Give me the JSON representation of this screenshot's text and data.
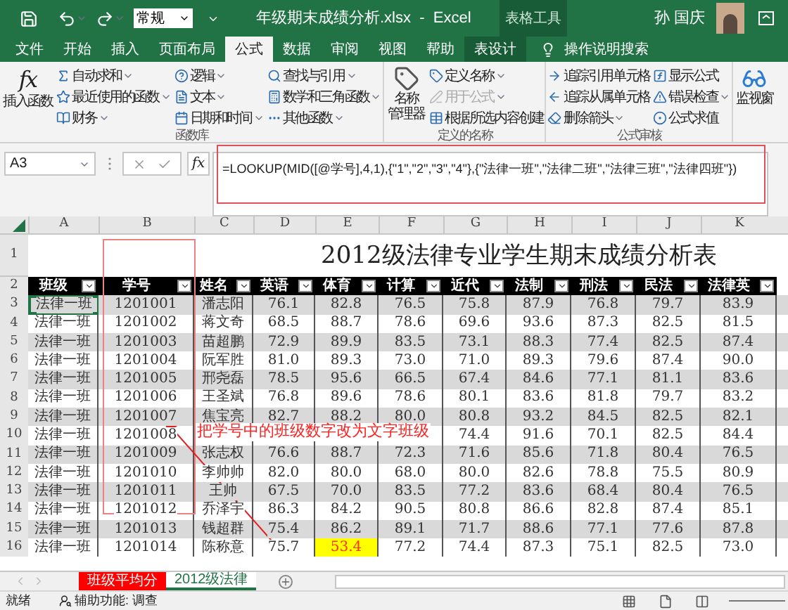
{
  "title_bar": {
    "number_format": "常规",
    "file_title": "年级期末成绩分析.xlsx  -  Excel",
    "context_tab": "表格工具",
    "user": "孙 国庆"
  },
  "tabs": [
    {
      "label": "文件",
      "selected": false,
      "kind": "normal"
    },
    {
      "label": "开始",
      "selected": false,
      "kind": "normal"
    },
    {
      "label": "插入",
      "selected": false,
      "kind": "normal"
    },
    {
      "label": "页面布局",
      "selected": false,
      "kind": "normal"
    },
    {
      "label": "公式",
      "selected": true,
      "kind": "normal"
    },
    {
      "label": "数据",
      "selected": false,
      "kind": "normal"
    },
    {
      "label": "审阅",
      "selected": false,
      "kind": "normal"
    },
    {
      "label": "视图",
      "selected": false,
      "kind": "normal"
    },
    {
      "label": "帮助",
      "selected": false,
      "kind": "normal"
    },
    {
      "label": "表设计",
      "selected": false,
      "kind": "contextual"
    }
  ],
  "search_hint": "操作说明搜索",
  "ribbon_groups": [
    {
      "label": "函数库",
      "large": [
        {
          "icon_text": "fx",
          "lines": [
            "插入函数"
          ]
        }
      ],
      "columns": [
        [
          {
            "label": "自动求和",
            "dropdown": true,
            "disabled": false
          },
          {
            "label": "最近使用的函数",
            "dropdown": true,
            "disabled": false
          },
          {
            "label": "财务",
            "dropdown": true,
            "disabled": false
          }
        ],
        [
          {
            "label": "逻辑",
            "dropdown": true,
            "disabled": false
          },
          {
            "label": "文本",
            "dropdown": true,
            "disabled": false
          },
          {
            "label": "日期和时间",
            "dropdown": true,
            "disabled": false
          }
        ],
        [
          {
            "label": "查找与引用",
            "dropdown": true,
            "disabled": false
          },
          {
            "label": "数学和三角函数",
            "dropdown": true,
            "disabled": false
          },
          {
            "label": "其他函数",
            "dropdown": true,
            "disabled": false
          }
        ]
      ]
    },
    {
      "label": "定义的名称",
      "large": [
        {
          "lines": [
            "名称",
            "管理器"
          ]
        }
      ],
      "columns": [
        [
          {
            "label": "定义名称",
            "dropdown": true,
            "disabled": false
          },
          {
            "label": "用于公式",
            "dropdown": true,
            "disabled": true
          },
          {
            "label": "根据所选内容创建",
            "dropdown": false,
            "disabled": false
          }
        ]
      ]
    },
    {
      "label": "公式审核",
      "columns": [
        [
          {
            "label": "追踪引用单元格",
            "dropdown": false,
            "disabled": false
          },
          {
            "label": "追踪从属单元格",
            "dropdown": false,
            "disabled": false
          },
          {
            "label": "删除箭头",
            "dropdown": true,
            "disabled": false
          }
        ],
        [
          {
            "label": "显示公式",
            "dropdown": false,
            "disabled": false
          },
          {
            "label": "错误检查",
            "dropdown": true,
            "disabled": false
          },
          {
            "label": "公式求值",
            "dropdown": false,
            "disabled": false
          }
        ]
      ]
    },
    {
      "large": [
        {
          "lines": [
            "监视窗"
          ]
        }
      ]
    }
  ],
  "formula_bar": {
    "name_box": "A3",
    "fx": "fx",
    "formula": "=LOOKUP(MID([@学号],4,1),{\"1\",\"2\",\"3\",\"4\"},{\"法律一班\",\"法律二班\",\"法律三班\",\"法律四班\"})"
  },
  "sheet": {
    "columns": [
      "A",
      "B",
      "C",
      "D",
      "E",
      "F",
      "G",
      "H",
      "I",
      "J",
      "K"
    ],
    "title_row": "1",
    "title": "2012级法律专业学生期末成绩分析表",
    "header_row": "2",
    "headers": [
      "班级",
      "学号",
      "姓名",
      "英语",
      "体育",
      "计算",
      "近代",
      "法制",
      "刑法",
      "民法",
      "法律英"
    ],
    "rows": [
      {
        "number": "3",
        "selected": {
          "A": true
        },
        "cells": {
          "A": "法律一班",
          "B": "1201001",
          "C": "潘志阳",
          "D": "76.1",
          "E": "82.8",
          "F": "76.5",
          "G": "75.8",
          "H": "87.9",
          "I": "76.8",
          "J": "79.7",
          "K": "83.9"
        }
      },
      {
        "number": "4",
        "cells": {
          "A": "法律一班",
          "B": "1201002",
          "C": "蒋文奇",
          "D": "68.5",
          "E": "88.7",
          "F": "78.6",
          "G": "69.6",
          "H": "93.6",
          "I": "87.3",
          "J": "82.5",
          "K": "81.5"
        }
      },
      {
        "number": "5",
        "cells": {
          "A": "法律一班",
          "B": "1201003",
          "C": "苗超鹏",
          "D": "72.9",
          "E": "89.9",
          "F": "83.5",
          "G": "73.1",
          "H": "88.3",
          "I": "77.4",
          "J": "82.5",
          "K": "87.4"
        }
      },
      {
        "number": "6",
        "cells": {
          "A": "法律一班",
          "B": "1201004",
          "C": "阮军胜",
          "D": "81.0",
          "E": "89.3",
          "F": "73.0",
          "G": "71.0",
          "H": "89.3",
          "I": "79.6",
          "J": "87.4",
          "K": "90.0"
        }
      },
      {
        "number": "7",
        "cells": {
          "A": "法律一班",
          "B": "1201005",
          "C": "邢尧磊",
          "D": "78.5",
          "E": "95.6",
          "F": "66.5",
          "G": "67.4",
          "H": "84.6",
          "I": "77.1",
          "J": "81.1",
          "K": "83.6"
        }
      },
      {
        "number": "8",
        "cells": {
          "A": "法律一班",
          "B": "1201006",
          "C": "王圣斌",
          "D": "76.8",
          "E": "89.6",
          "F": "78.6",
          "G": "80.1",
          "H": "83.6",
          "I": "81.8",
          "J": "79.7",
          "K": "83.2"
        }
      },
      {
        "number": "9",
        "cells": {
          "A": "法律一班",
          "B": "1201007",
          "C": "焦宝亮",
          "D": "82.7",
          "E": "88.2",
          "F": "80.0",
          "G": "80.8",
          "H": "93.2",
          "I": "84.5",
          "J": "82.5",
          "K": "82.1"
        }
      },
      {
        "number": "10",
        "cells": {
          "A": "法律一班",
          "B": "1201008",
          "G": "74.4",
          "H": "91.6",
          "I": "70.1",
          "J": "82.5",
          "K": "84.4"
        }
      },
      {
        "number": "11",
        "cells": {
          "A": "法律一班",
          "B": "1201009",
          "C": "张志权",
          "D": "76.6",
          "E": "88.7",
          "F": "72.3",
          "G": "71.6",
          "H": "85.6",
          "I": "71.8",
          "J": "80.4",
          "K": "76.5"
        }
      },
      {
        "number": "12",
        "cells": {
          "A": "法律一班",
          "B": "1201010",
          "C": "李帅帅",
          "D": "82.0",
          "E": "80.0",
          "F": "68.0",
          "G": "80.0",
          "H": "82.6",
          "I": "78.8",
          "J": "75.5",
          "K": "80.9"
        }
      },
      {
        "number": "13",
        "cells": {
          "A": "法律一班",
          "B": "1201011",
          "C": "王帅",
          "D": "67.5",
          "E": "70.0",
          "F": "83.5",
          "G": "77.2",
          "H": "83.6",
          "I": "68.4",
          "J": "80.4",
          "K": "76.5"
        }
      },
      {
        "number": "14",
        "cells": {
          "A": "法律一班",
          "B": "1201012",
          "C": "乔泽宇",
          "D": "86.3",
          "E": "84.2",
          "F": "90.5",
          "G": "80.8",
          "H": "86.6",
          "I": "82.8",
          "J": "87.4",
          "K": "85.1"
        }
      },
      {
        "number": "15",
        "cells": {
          "A": "法律一班",
          "B": "1201013",
          "C": "钱超群",
          "D": "75.4",
          "E": "86.2",
          "F": "89.1",
          "G": "71.7",
          "H": "88.6",
          "I": "77.1",
          "J": "77.6",
          "K": "87.8"
        }
      },
      {
        "number": "16",
        "highlight": {
          "E": true
        },
        "cells": {
          "A": "法律一班",
          "B": "1201014",
          "C": "陈称意",
          "D": "75.7",
          "E": "53.4",
          "F": "77.2",
          "G": "74.4",
          "H": "87.3",
          "I": "75.1",
          "J": "82.5",
          "K": "73.0"
        }
      }
    ]
  },
  "annotation": {
    "text": "把学号中的班级数字改为文字班级"
  },
  "sheet_tabs": [
    {
      "label": "班级平均分",
      "selected": false,
      "color": "#ff0000"
    },
    {
      "label": "2012级法律",
      "selected": true
    }
  ],
  "status_bar": {
    "status": "就绪",
    "accessibility": "辅助功能: 调查"
  }
}
